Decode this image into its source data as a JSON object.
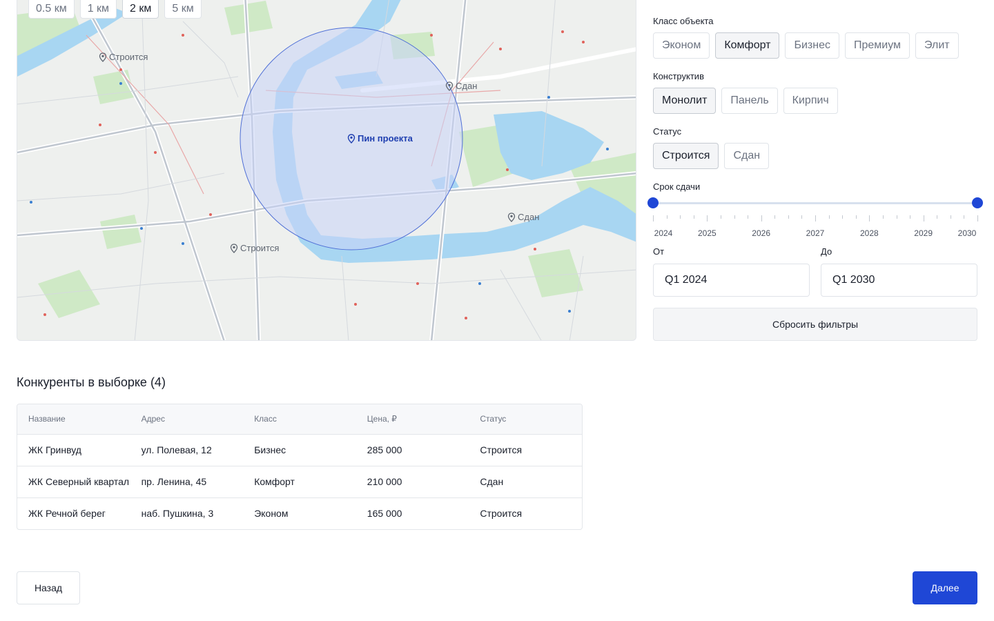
{
  "map": {
    "radius_options": [
      "0.5 км",
      "1 км",
      "2 км",
      "5 км"
    ],
    "selected_radius": "2 км",
    "project_pin_label": "Пин проекта",
    "pins": {
      "p1": "Строится",
      "p2": "Сдан",
      "p3": "Сдан",
      "p4": "Строится"
    },
    "colors": {
      "water": "#a8d6f2",
      "park": "#cfe9c6",
      "radius_fill": "#c9d4f7",
      "radius_stroke": "#4f6fd6"
    }
  },
  "filters": {
    "class_label": "Класс объекта",
    "class_options": [
      "Эконом",
      "Комфорт",
      "Бизнес",
      "Премиум",
      "Элит"
    ],
    "class_selected": "Комфорт",
    "construct_label": "Конструктив",
    "construct_options": [
      "Монолит",
      "Панель",
      "Кирпич"
    ],
    "construct_selected": "Монолит",
    "status_label": "Статус",
    "status_options": [
      "Строится",
      "Сдан"
    ],
    "status_selected": "Строится",
    "deadline_label": "Срок сдачи",
    "years": [
      "2024",
      "2025",
      "2026",
      "2027",
      "2028",
      "2029",
      "2030"
    ],
    "range_from_year": 2024,
    "range_to_year": 2030,
    "from_label": "От",
    "from_value": "Q1 2024",
    "to_label": "До",
    "to_value": "Q1 2030",
    "reset_label": "Сбросить фильтры",
    "accent": "#1f47d6"
  },
  "competitors": {
    "title": "Конкуренты в выборке (4)",
    "columns": [
      "Название",
      "Адрес",
      "Класс",
      "Цена, ₽",
      "Статус"
    ],
    "rows": [
      [
        "ЖК Гринвуд",
        "ул. Полевая, 12",
        "Бизнес",
        "285 000",
        "Строится"
      ],
      [
        "ЖК Северный квартал",
        "пр. Ленина, 45",
        "Комфорт",
        "210 000",
        "Сдан"
      ],
      [
        "ЖК Речной берег",
        "наб. Пушкина, 3",
        "Эконом",
        "165 000",
        "Строится"
      ]
    ]
  },
  "footer": {
    "back_label": "Назад",
    "next_label": "Далее"
  }
}
